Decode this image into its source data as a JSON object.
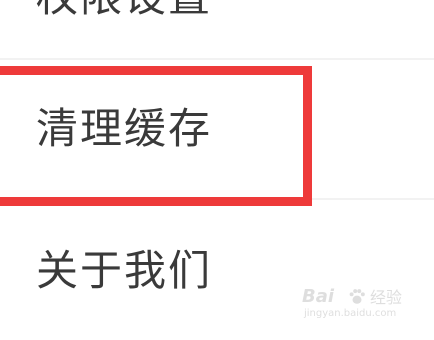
{
  "settings_list": {
    "items": [
      {
        "label": "权限设置"
      },
      {
        "label": "清理缓存"
      },
      {
        "label": "关于我们"
      }
    ]
  },
  "highlight": {
    "target": "清理缓存",
    "color": "#ee3a3a"
  },
  "watermark": {
    "brand": "Bai",
    "suffix": "经验",
    "domain": "jingyan.baidu.com"
  },
  "colors": {
    "text": "#3a3a3a",
    "divider": "#f2f2f2",
    "background": "#ffffff"
  }
}
